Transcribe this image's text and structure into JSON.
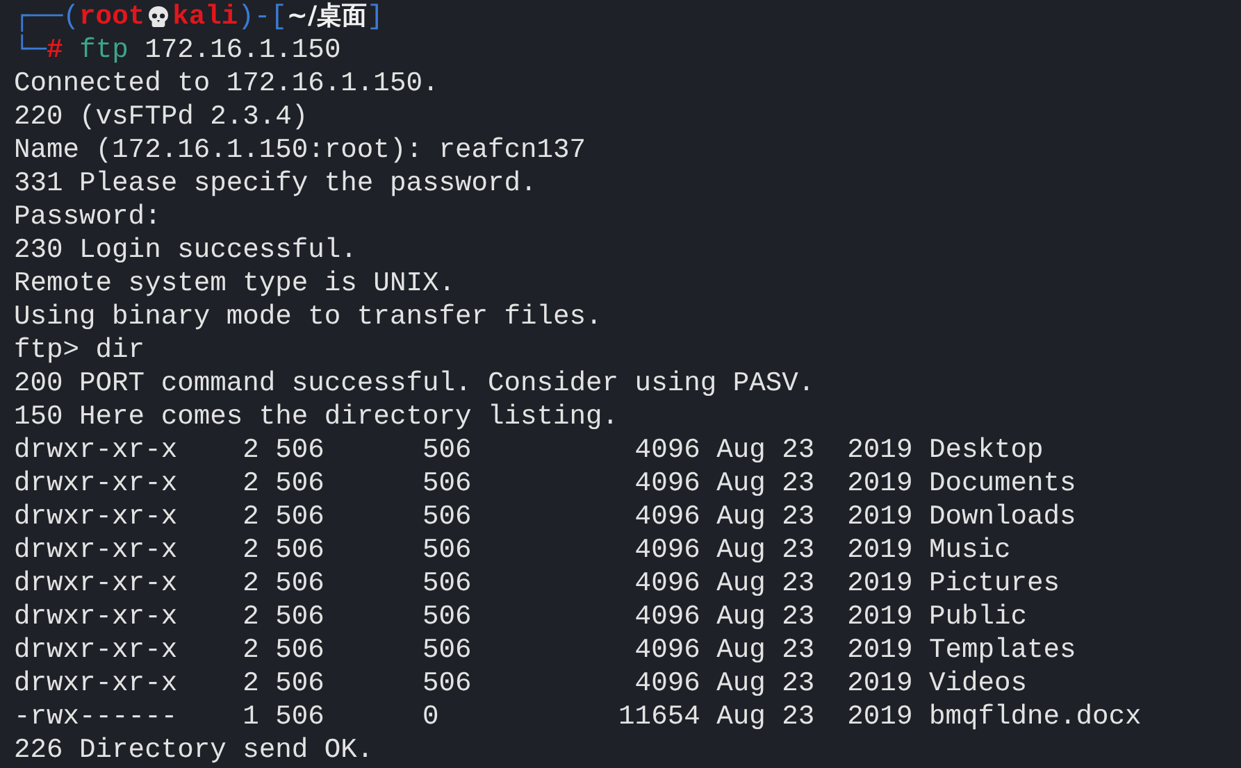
{
  "prompt": {
    "corner_top": "┌──(",
    "user": "root",
    "host": "kali",
    "separator": ")-[",
    "path": "~/桌面",
    "close": "]",
    "corner_bottom": "└─",
    "symbol": "#"
  },
  "command": {
    "program": "ftp",
    "args": "172.16.1.150"
  },
  "output": [
    "Connected to 172.16.1.150.",
    "220 (vsFTPd 2.3.4)",
    "Name (172.16.1.150:root): reafcn137",
    "331 Please specify the password.",
    "Password:",
    "230 Login successful.",
    "Remote system type is UNIX.",
    "Using binary mode to transfer files.",
    "ftp> dir",
    "200 PORT command successful. Consider using PASV.",
    "150 Here comes the directory listing.",
    "drwxr-xr-x    2 506      506          4096 Aug 23  2019 Desktop",
    "drwxr-xr-x    2 506      506          4096 Aug 23  2019 Documents",
    "drwxr-xr-x    2 506      506          4096 Aug 23  2019 Downloads",
    "drwxr-xr-x    2 506      506          4096 Aug 23  2019 Music",
    "drwxr-xr-x    2 506      506          4096 Aug 23  2019 Pictures",
    "drwxr-xr-x    2 506      506          4096 Aug 23  2019 Public",
    "drwxr-xr-x    2 506      506          4096 Aug 23  2019 Templates",
    "drwxr-xr-x    2 506      506          4096 Aug 23  2019 Videos",
    "-rwx------    1 506      0           11654 Aug 23  2019 bmqfldne.docx",
    "226 Directory send OK."
  ]
}
